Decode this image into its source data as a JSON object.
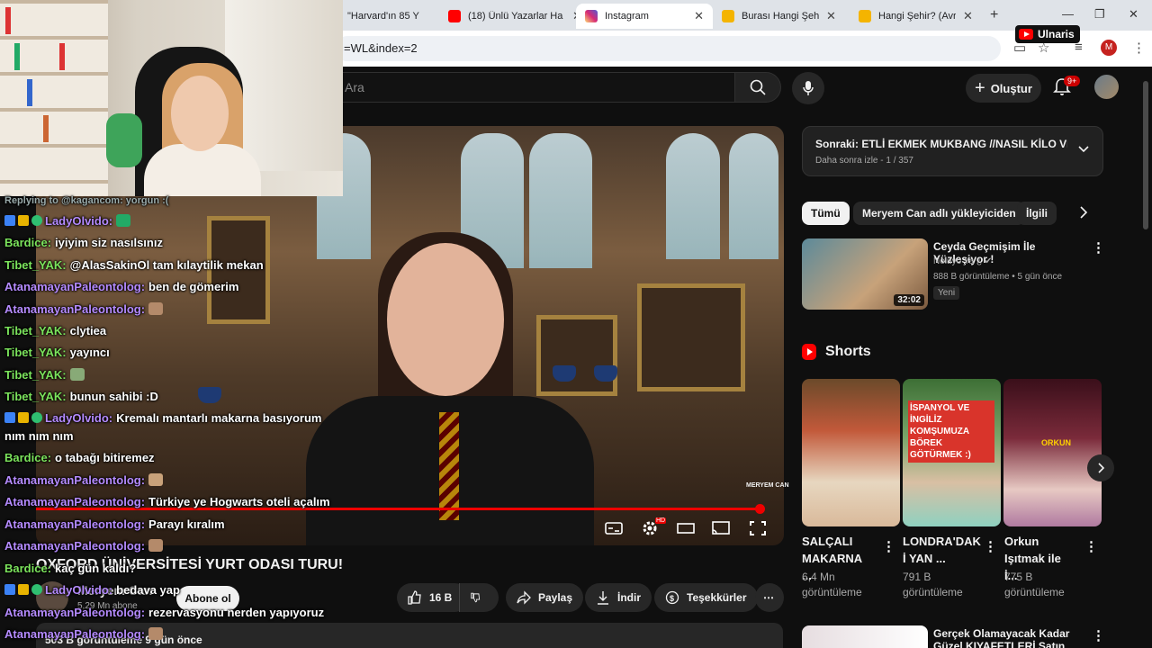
{
  "browser": {
    "tabs": [
      {
        "title": "\"Harvard'ın 85 Y",
        "icon_color": "#ff0000"
      },
      {
        "title": "(18) Ünlü Yazarlar Ha",
        "icon_color": "#ff0000"
      },
      {
        "title": "Instagram",
        "icon_color": "#d62976"
      },
      {
        "title": "Burası Hangi Şehir? (",
        "icon_color": "#f4b400"
      },
      {
        "title": "Hangi Şehir? (Avrupa",
        "icon_color": "#f4b400"
      }
    ],
    "url": "=WL&index=2",
    "profile_initial": "M",
    "overlay_badge": "Ulnaris"
  },
  "youtube": {
    "search_placeholder": "Ara",
    "create_label": "Oluştur",
    "notif_count": "9+"
  },
  "video": {
    "title": "OXFORD ÜNİVERSİTESİ YURT ODASI TURU!",
    "channel_name": "Meryem Can",
    "subscribers": "5,29 Mn abone",
    "subscribe_label": "Abone ol",
    "likes": "16 B",
    "share_label": "Paylaş",
    "download_label": "İndir",
    "thanks_label": "Teşekkürler",
    "description_meta": "503 B görüntüleme  9 gün önce",
    "watermark": "MERYEM CAN",
    "progress_percent": 100
  },
  "sidebar": {
    "playlist": {
      "title": "Sonraki: ETLİ EKMEK MUKBANG //NASIL KİLO VER...",
      "sub": "Daha sonra izle - 1 / 357"
    },
    "chips": [
      "Tümü",
      "Meryem Can adlı yükleyiciden",
      "İlgili"
    ],
    "rec": {
      "title": "Ceyda Geçmişim İle Yüzleşiyor !",
      "channel": "Noluyo Ya ¿",
      "meta": "888 B görüntüleme • 5 gün önce",
      "badge": "Yeni",
      "duration": "32:02"
    },
    "shorts_label": "Shorts",
    "shorts": [
      {
        "title": "SALÇALI MAKARNA ...",
        "views": "6,4 Mn görüntüleme"
      },
      {
        "title": "LONDRA'DAK İ YAN ...",
        "views": "791 B görüntüleme",
        "overlay": "İSPANYOL VE İNGİLİZ KOMŞUMUZA BÖREK GÖTÜRMEK :)"
      },
      {
        "title": "Orkun Işıtmak ile İ...",
        "views": "775 B görüntüleme",
        "overlay": "ORKUN"
      }
    ],
    "rec2": {
      "title": "Gerçek Olamayacak Kadar Güzel KIYAFETLERİ Satın Aldı"
    }
  },
  "chat": {
    "reply": "Replying to @kagancom: yorgun :(",
    "messages": [
      {
        "user": "LadyOlvido:",
        "text": "",
        "color": "#b58bff"
      },
      {
        "user": "Bardice:",
        "text": "iyiyim siz nasılsınız",
        "color": "#7be35c"
      },
      {
        "user": "Tibet_YAK:",
        "text": "@AlasSakinOl tam kılaytilik mekan",
        "color": "#7be35c"
      },
      {
        "user": "AtanamayanPaleontolog:",
        "text": "ben de gömerim",
        "color": "#b58bff"
      },
      {
        "user": "AtanamayanPaleontolog:",
        "text": "",
        "color": "#b58bff"
      },
      {
        "user": "Tibet_YAK:",
        "text": "clytiea",
        "color": "#7be35c"
      },
      {
        "user": "Tibet_YAK:",
        "text": "yayıncı",
        "color": "#7be35c"
      },
      {
        "user": "Tibet_YAK:",
        "text": "",
        "color": "#7be35c"
      },
      {
        "user": "Tibet_YAK:",
        "text": "bunun sahibi :D",
        "color": "#7be35c"
      },
      {
        "user": "LadyOlvido:",
        "text": "Kremalı mantarlı makarna basıyorum",
        "color": "#b58bff"
      },
      {
        "user": "",
        "text": "nım nım nım",
        "color": "#ffffff"
      },
      {
        "user": "Bardice:",
        "text": "o tabağı bitiremez",
        "color": "#7be35c"
      },
      {
        "user": "AtanamayanPaleontolog:",
        "text": "",
        "color": "#b58bff"
      },
      {
        "user": "AtanamayanPaleontolog:",
        "text": "Türkiye ye Hogwarts oteli açalım",
        "color": "#b58bff"
      },
      {
        "user": "AtanamayanPaleontolog:",
        "text": "Parayı kıralım",
        "color": "#b58bff"
      },
      {
        "user": "AtanamayanPaleontolog:",
        "text": "",
        "color": "#b58bff"
      },
      {
        "user": "Bardice:",
        "text": "kaç gün kaldı?",
        "color": "#7be35c"
      },
      {
        "user": "LadyOlvido:",
        "text": "bedava yap",
        "color": "#b58bff"
      },
      {
        "user": "AtanamayanPaleontolog:",
        "text": "rezervasyonu nerden yapıyoruz",
        "color": "#b58bff"
      },
      {
        "user": "AtanamayanPaleontolog:",
        "text": "",
        "color": "#b58bff"
      }
    ]
  }
}
